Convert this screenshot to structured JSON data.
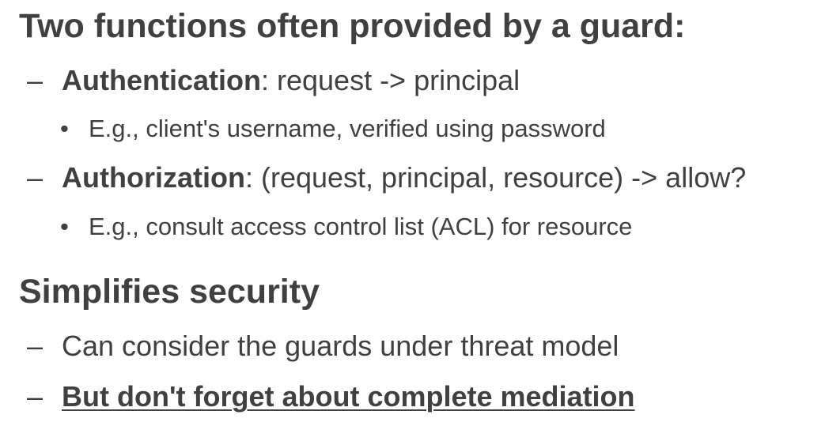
{
  "section1": {
    "heading": "Two functions often provided by a guard:",
    "items": [
      {
        "marker": "–",
        "term": "Authentication",
        "rest": ": request -> principal",
        "sub": {
          "marker": "•",
          "text": "E.g., client's username, verified using password"
        }
      },
      {
        "marker": "–",
        "term": "Authorization",
        "rest": ": (request, principal, resource) -> allow?",
        "sub": {
          "marker": "•",
          "text": "E.g., consult access control list (ACL) for resource"
        }
      }
    ]
  },
  "section2": {
    "heading": "Simplifies security",
    "items": [
      {
        "marker": "–",
        "text": "Can consider the guards under threat model"
      },
      {
        "marker": "–",
        "text": "But don't forget about complete mediation"
      }
    ]
  },
  "colors": {
    "text": "#404040",
    "background": "#ffffff"
  }
}
